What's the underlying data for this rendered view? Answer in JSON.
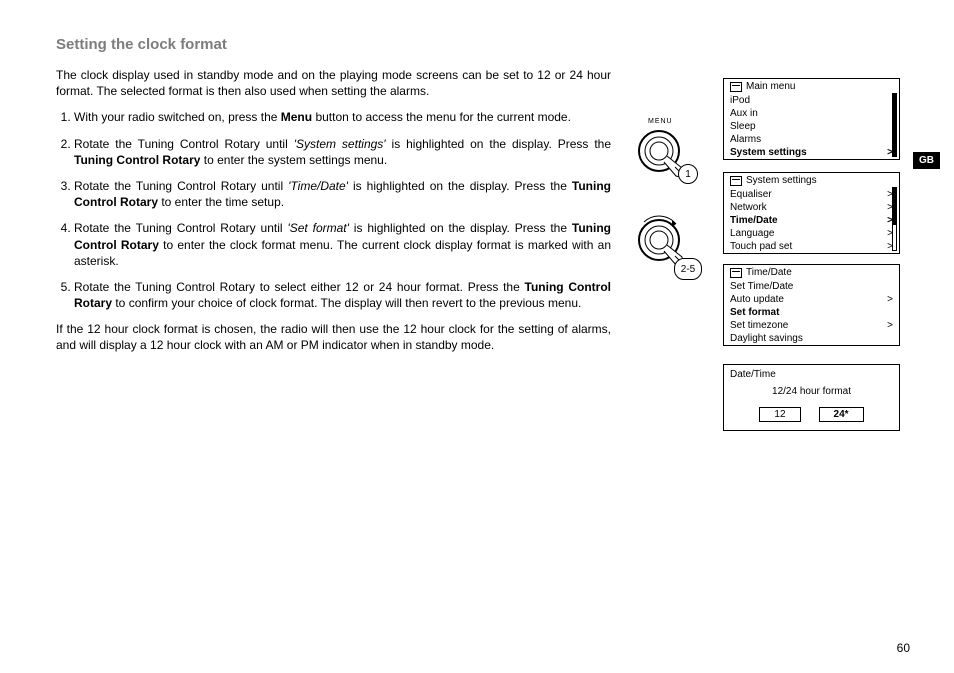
{
  "heading": "Setting the clock format",
  "intro": "The clock display used in standby mode and on the playing mode screens can be set to 12 or 24 hour format. The selected format is then also used when setting the alarms.",
  "steps": {
    "s1a": "With your radio switched on, press the ",
    "s1b": "Menu",
    "s1c": " button to access the menu for the current mode.",
    "s2a": "Rotate the Tuning Control Rotary until ",
    "s2b": "'System settings'",
    "s2c": " is highlighted on the display. Press the ",
    "s2d": "Tuning Control Rotary",
    "s2e": " to enter the system settings menu.",
    "s3a": "Rotate the Tuning Control Rotary until ",
    "s3b": "'Time/Date'",
    "s3c": " is highlighted on the display. Press the ",
    "s3d": "Tuning Control Rotary",
    "s3e": " to enter the time setup.",
    "s4a": "Rotate the Tuning Control Rotary until ",
    "s4b": "'Set format'",
    "s4c": " is highlighted on the display. Press the ",
    "s4d": "Tuning Control Rotary",
    "s4e": " to enter the clock format menu. The current clock display format is marked with an asterisk.",
    "s5a": "Rotate the Tuning Control Rotary to select either 12 or 24 hour format. Press the ",
    "s5b": "Tuning Control Rotary",
    "s5c": " to confirm your choice of clock format. The display will then revert to the previous menu."
  },
  "outro": "If the 12 hour clock format is chosen, the radio will then use the 12 hour clock for the setting of alarms, and will display a 12 hour clock with an AM or PM indicator when in standby mode.",
  "menu_label": "MENU",
  "badge1": "1",
  "badge2": "2-5",
  "gb": "GB",
  "page_num": "60",
  "lcd_main": {
    "title": "Main menu",
    "items": [
      "iPod",
      "Aux in",
      "Sleep",
      "Alarms"
    ],
    "selected": "System settings",
    "arrow": ">"
  },
  "lcd_sys": {
    "title": "System settings",
    "r1": "Equaliser",
    "r2": "Network",
    "r3": "Time/Date",
    "r4": "Language",
    "r5": "Touch pad set",
    "arrow": ">"
  },
  "lcd_td": {
    "title": "Time/Date",
    "r1": "Set Time/Date",
    "r2": "Auto update",
    "r3": "Set format",
    "r4": "Set timezone",
    "r5": "Daylight savings",
    "arrow": ">"
  },
  "lcd_fmt": {
    "title": "Date/Time",
    "subtitle": "12/24 hour format",
    "opt1": "12",
    "opt2": "24*"
  }
}
